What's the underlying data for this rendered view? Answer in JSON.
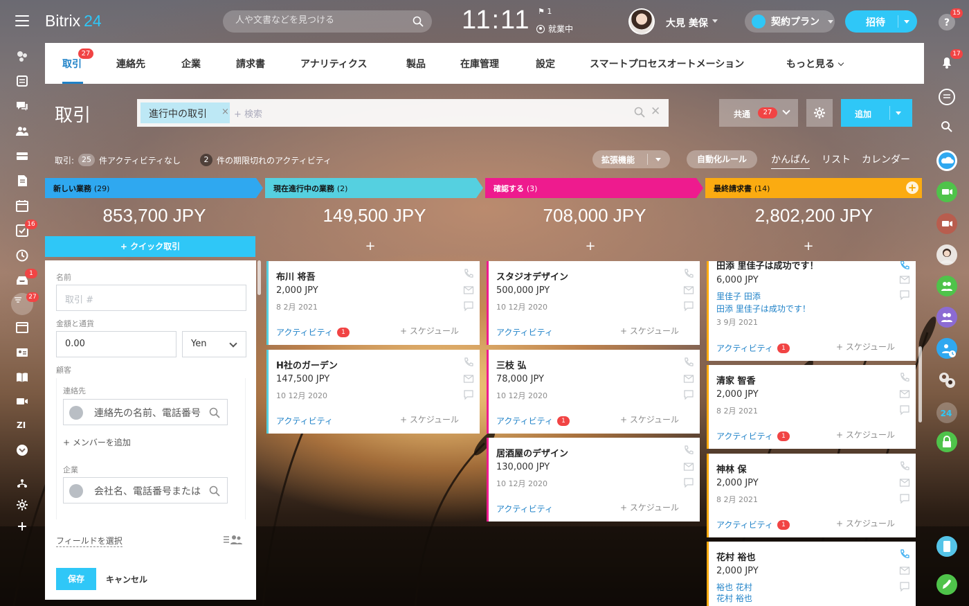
{
  "topbar": {
    "logo_text": "Bitrix",
    "logo_num": "24",
    "search_placeholder": "人や文書などを見つける",
    "clock": "11:11",
    "flag_count": "1",
    "work_status": "就業中",
    "user_name": "大見 美保",
    "plan_label": "契約プラン",
    "invite_label": "招待"
  },
  "left_sidebar": {
    "items": [
      {
        "icon": "feed-icon"
      },
      {
        "icon": "tasks-icon"
      },
      {
        "icon": "chat-icon"
      },
      {
        "icon": "group-icon"
      },
      {
        "icon": "drive-icon"
      },
      {
        "icon": "document-icon"
      },
      {
        "icon": "calendar-icon"
      },
      {
        "icon": "task-check-icon",
        "badge": "16"
      },
      {
        "icon": "time-icon"
      },
      {
        "icon": "inbox-icon",
        "badge": "1"
      },
      {
        "icon": "crm-filter-icon",
        "badge": "27"
      },
      {
        "icon": "sites-icon"
      },
      {
        "icon": "contact-card-icon"
      },
      {
        "icon": "knowledge-base-icon"
      },
      {
        "icon": "video-icon"
      },
      {
        "icon": "zi-icon",
        "text": "ZI"
      },
      {
        "icon": "more-icon"
      },
      {
        "icon": "structure-icon"
      },
      {
        "icon": "settings-icon"
      },
      {
        "icon": "add-icon"
      }
    ]
  },
  "right_sidebar": {
    "help_badge": "15",
    "notify_badge": "17"
  },
  "tabs": [
    {
      "label": "取引",
      "active": true,
      "badge": "27"
    },
    {
      "label": "連絡先"
    },
    {
      "label": "企業"
    },
    {
      "label": "請求書"
    },
    {
      "label": "アナリティクス"
    },
    {
      "label": "製品"
    },
    {
      "label": "在庫管理"
    },
    {
      "label": "設定"
    },
    {
      "label": "スマートプロセスオートメーション"
    },
    {
      "label": "もっと見る"
    }
  ],
  "page": {
    "title": "取引",
    "filter_tag": "進行中の取引",
    "filter_search_placeholder": "+ 検索",
    "common_label": "共通",
    "common_count": "27",
    "add_label": "追加"
  },
  "stats": {
    "prefix": "取引:",
    "no_activity_count": "25",
    "no_activity_text": "件アクティビティなし",
    "overdue_count": "2",
    "overdue_text": "件の期限切れのアクティビティ"
  },
  "toolbar": {
    "extensions": "拡張機能",
    "automation": "自動化ルール",
    "views": [
      "かんばん",
      "リスト",
      "カレンダー"
    ]
  },
  "columns": [
    {
      "name": "新しい業務",
      "count": "(29)",
      "total": "853,700 JPY",
      "color": "#2fa8f0"
    },
    {
      "name": "現在進行中の業務",
      "count": "(2)",
      "total": "149,500 JPY",
      "color": "#55d0e0"
    },
    {
      "name": "確認する",
      "count": "(3)",
      "total": "708,000 JPY",
      "color": "#ee1b8e"
    },
    {
      "name": "最終請求書",
      "count": "(14)",
      "total": "2,802,200 JPY",
      "color": "#fbab11"
    }
  ],
  "quick_form": {
    "button": "+ クイック取引",
    "name_label": "名前",
    "name_placeholder": "取引 #",
    "amount_label": "金額と通貨",
    "amount_value": "0.00",
    "currency": "Yen",
    "customer_label": "顧客",
    "contact_label": "連絡先",
    "contact_placeholder": "連絡先の名前、電話番号",
    "add_member": "+ メンバーを追加",
    "company_label": "企業",
    "company_placeholder": "会社名、電話番号または",
    "field_select": "フィールドを選択",
    "save": "保存",
    "cancel": "キャンセル"
  },
  "card_common": {
    "activity": "アクティビティ",
    "schedule": "+ スケジュール"
  },
  "cards": {
    "col2": [
      {
        "title": "布川 将吾",
        "amount": "2,000 JPY",
        "date": "8 2月 2021",
        "badge": "1"
      },
      {
        "title": "H社のガーデン",
        "amount": "147,500 JPY",
        "date": "10 12月 2020"
      }
    ],
    "col3": [
      {
        "title": "スタジオデザイン",
        "amount": "500,000 JPY",
        "date": "10 12月 2020"
      },
      {
        "title": "三枝 弘",
        "amount": "78,000 JPY",
        "date": "10 12月 2020",
        "badge": "1"
      },
      {
        "title": "居酒屋のデザイン",
        "amount": "130,000 JPY",
        "date": "10 12月 2020"
      }
    ],
    "col4": [
      {
        "title": "田添 里佳子は成功です！",
        "amount": "6,000 JPY",
        "link1": "里佳子 田添",
        "link2": "田添 里佳子は成功です！",
        "date": "3 9月 2021",
        "badge": "1"
      },
      {
        "title": "清家 智香",
        "amount": "2,000 JPY",
        "date": "8 2月 2021",
        "badge": "1"
      },
      {
        "title": "神林 保",
        "amount": "2,000 JPY",
        "date": "8 2月 2021",
        "badge": "1"
      },
      {
        "title": "花村 裕也",
        "amount": "2,000 JPY",
        "link1": "裕也 花村",
        "link2": "花村 裕也"
      }
    ]
  }
}
